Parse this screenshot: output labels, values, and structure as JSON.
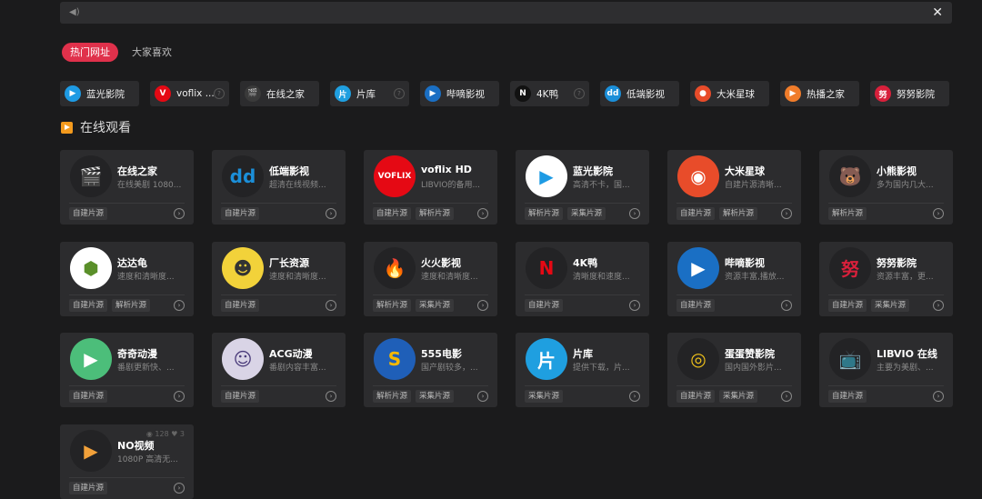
{
  "topbar": {
    "speaker_icon": "speaker-icon",
    "close_label": "✕"
  },
  "tabs": [
    {
      "label": "热门网址",
      "active": true
    },
    {
      "label": "大家喜欢",
      "active": false
    }
  ],
  "quick_links": [
    {
      "label": "蓝光影院",
      "color": "#1e9be4",
      "glyph": "▶",
      "more": false
    },
    {
      "label": "voflix ...",
      "color": "#e50914",
      "glyph": "V",
      "more": true
    },
    {
      "label": "在线之家",
      "color": "#3a3a3a",
      "glyph": "🎬",
      "more": false
    },
    {
      "label": "片库",
      "color": "#1f9fe0",
      "glyph": "片",
      "more": true
    },
    {
      "label": "哔嘀影视",
      "color": "#1a6fc4",
      "glyph": "▶",
      "more": false
    },
    {
      "label": "4K鸭",
      "color": "#111",
      "glyph": "N",
      "more": true
    },
    {
      "label": "低端影视",
      "color": "#1b8fd9",
      "glyph": "dd",
      "more": false
    },
    {
      "label": "大米星球",
      "color": "#e84c2a",
      "glyph": "●",
      "more": false
    },
    {
      "label": "热播之家",
      "color": "#f07c2a",
      "glyph": "▶",
      "more": false
    },
    {
      "label": "努努影院",
      "color": "#d8203b",
      "glyph": "努",
      "more": false
    }
  ],
  "section": {
    "title": "在线观看"
  },
  "cards": [
    {
      "name": "在线之家",
      "desc": "在线美剧 1080...",
      "tags": [
        "自建片源"
      ],
      "logo_bg": "#232325",
      "logo_glyph": "🎬",
      "logo_color": "#e3b12a"
    },
    {
      "name": "低端影视",
      "desc": "超清在线视频...",
      "tags": [
        "自建片源"
      ],
      "logo_bg": "#232325",
      "logo_glyph": "dd",
      "logo_color": "#1b8fd9"
    },
    {
      "name": "voflix HD",
      "desc": "LIBVIO的备用...",
      "tags": [
        "自建片源",
        "解析片源"
      ],
      "logo_bg": "#e50914",
      "logo_glyph": "VOFLIX",
      "logo_color": "#ffffff"
    },
    {
      "name": "蓝光影院",
      "desc": "高清不卡，国...",
      "tags": [
        "解析片源",
        "采集片源"
      ],
      "logo_bg": "#ffffff",
      "logo_glyph": "▶",
      "logo_color": "#1e9be4"
    },
    {
      "name": "大米星球",
      "desc": "自建片源清晰...",
      "tags": [
        "自建片源",
        "解析片源"
      ],
      "logo_bg": "#e84c2a",
      "logo_glyph": "◉",
      "logo_color": "#ffffff"
    },
    {
      "name": "小熊影视",
      "desc": "多为国内几大...",
      "tags": [
        "解析片源"
      ],
      "logo_bg": "#232325",
      "logo_glyph": "🐻",
      "logo_color": "#e23a4a"
    },
    {
      "name": "达达龟",
      "desc": "速度和清晰度...",
      "tags": [
        "自建片源",
        "解析片源"
      ],
      "logo_bg": "#ffffff",
      "logo_glyph": "⬢",
      "logo_color": "#5a8f2a"
    },
    {
      "name": "厂长资源",
      "desc": "速度和清晰度...",
      "tags": [
        "自建片源"
      ],
      "logo_bg": "#f2d23a",
      "logo_glyph": "☻",
      "logo_color": "#333333"
    },
    {
      "name": "火火影视",
      "desc": "速度和清晰度...",
      "tags": [
        "解析片源",
        "采集片源"
      ],
      "logo_bg": "#232325",
      "logo_glyph": "🔥",
      "logo_color": "#f26b1d"
    },
    {
      "name": "4K鸭",
      "desc": "清晰度和速度...",
      "tags": [
        "自建片源"
      ],
      "logo_bg": "#232325",
      "logo_glyph": "N",
      "logo_color": "#e50914"
    },
    {
      "name": "哔嘀影视",
      "desc": "资源丰富,播放...",
      "tags": [
        "自建片源"
      ],
      "logo_bg": "#1a6fc4",
      "logo_glyph": "▶",
      "logo_color": "#ffffff"
    },
    {
      "name": "努努影院",
      "desc": "资源丰富，更...",
      "tags": [
        "自建片源",
        "采集片源"
      ],
      "logo_bg": "#232325",
      "logo_glyph": "努",
      "logo_color": "#d8203b"
    },
    {
      "name": "奇奇动漫",
      "desc": "番剧更新快、...",
      "tags": [
        "自建片源"
      ],
      "logo_bg": "#4cbe7a",
      "logo_glyph": "▶",
      "logo_color": "#ffffff"
    },
    {
      "name": "ACG动漫",
      "desc": "番剧内容丰富...",
      "tags": [
        "自建片源"
      ],
      "logo_bg": "#d9d4e6",
      "logo_glyph": "☺",
      "logo_color": "#4a3b7a"
    },
    {
      "name": "555电影",
      "desc": "国产剧较多，...",
      "tags": [
        "解析片源",
        "采集片源"
      ],
      "logo_bg": "#1f5fb8",
      "logo_glyph": "S",
      "logo_color": "#f5b800"
    },
    {
      "name": "片库",
      "desc": "提供下载，片...",
      "tags": [
        "采集片源"
      ],
      "logo_bg": "#1f9fe0",
      "logo_glyph": "片",
      "logo_color": "#ffffff"
    },
    {
      "name": "蛋蛋赞影院",
      "desc": "国内国外影片...",
      "tags": [
        "自建片源",
        "采集片源"
      ],
      "logo_bg": "#232325",
      "logo_glyph": "◎",
      "logo_color": "#f0c21a"
    },
    {
      "name": "LIBVIO 在线",
      "desc": "主要为美剧、...",
      "tags": [
        "自建片源"
      ],
      "logo_bg": "#232325",
      "logo_glyph": "📺",
      "logo_color": "#f5b800"
    },
    {
      "name": "NO视频",
      "desc": "1080P 高清无...",
      "tags": [
        "自建片源"
      ],
      "logo_bg": "#232325",
      "logo_glyph": "▶",
      "logo_color": "#f2a13a",
      "stats": "◉ 128  ♥ 3"
    }
  ]
}
